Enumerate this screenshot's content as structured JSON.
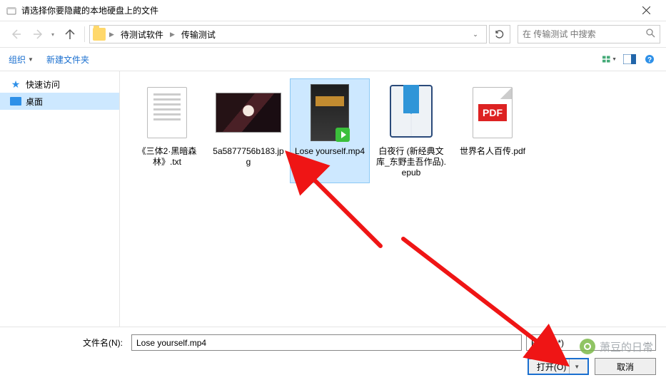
{
  "title": "请选择你要隐藏的本地硬盘上的文件",
  "breadcrumbs": {
    "a": "待测试软件",
    "b": "传输测试"
  },
  "search": {
    "placeholder": "在 传输测试 中搜索"
  },
  "toolbar": {
    "organize": "组织",
    "newfolder": "新建文件夹"
  },
  "sidebar": {
    "items": [
      {
        "label": "快速访问"
      },
      {
        "label": "桌面"
      }
    ]
  },
  "files": [
    {
      "label": "《三体2·黑暗森林》.txt"
    },
    {
      "label": "5a5877756b183.jpg"
    },
    {
      "label": "Lose yourself.mp4"
    },
    {
      "label": "白夜行 (新经典文库_东野圭吾作品).epub"
    },
    {
      "label": "世界名人百传.pdf"
    }
  ],
  "pdf_badge": "PDF",
  "footer": {
    "fn_label": "文件名(N):",
    "fn_value": "Lose yourself.mp4",
    "filetype": "Files(*.*)",
    "open": "打开(O)",
    "cancel": "取消"
  },
  "watermark": "萧豆的日常"
}
